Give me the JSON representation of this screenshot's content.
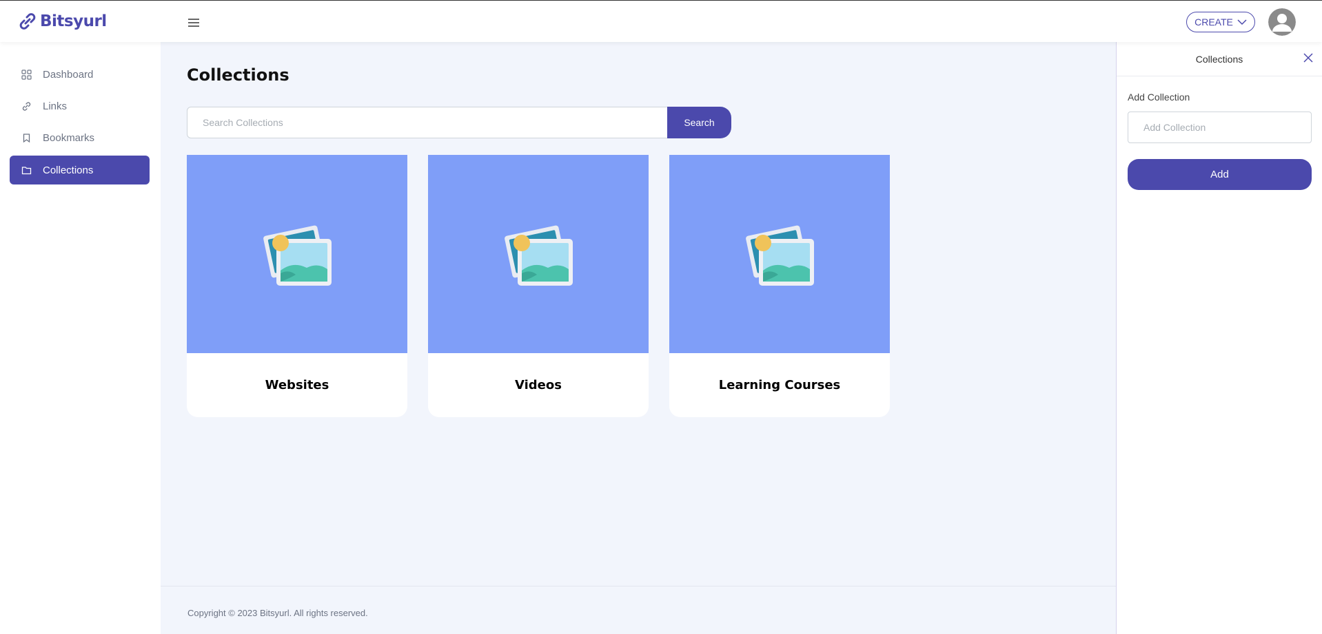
{
  "app": {
    "name": "Bitsyurl"
  },
  "header": {
    "create_label": "CREATE"
  },
  "sidebar": {
    "items": [
      {
        "label": "Dashboard",
        "icon": "grid-icon",
        "active": false
      },
      {
        "label": "Links",
        "icon": "link-icon",
        "active": false
      },
      {
        "label": "Bookmarks",
        "icon": "bookmark-icon",
        "active": false
      },
      {
        "label": "Collections",
        "icon": "folder-icon",
        "active": true
      }
    ]
  },
  "main": {
    "title": "Collections",
    "search": {
      "placeholder": "Search Collections",
      "button_label": "Search"
    },
    "collections": [
      {
        "title": "Websites",
        "icon": "image-placeholder-icon"
      },
      {
        "title": "Videos",
        "icon": "image-placeholder-icon"
      },
      {
        "title": "Learning Courses",
        "icon": "image-placeholder-icon"
      }
    ],
    "footer": "Copyright © 2023 Bitsyurl. All rights reserved."
  },
  "panel": {
    "title": "Collections",
    "field_label": "Add Collection",
    "field_placeholder": "Add Collection",
    "add_label": "Add"
  },
  "colors": {
    "accent": "#4b49ac",
    "card_image_bg": "#7f9ef8",
    "page_bg": "#f2f5fc"
  }
}
